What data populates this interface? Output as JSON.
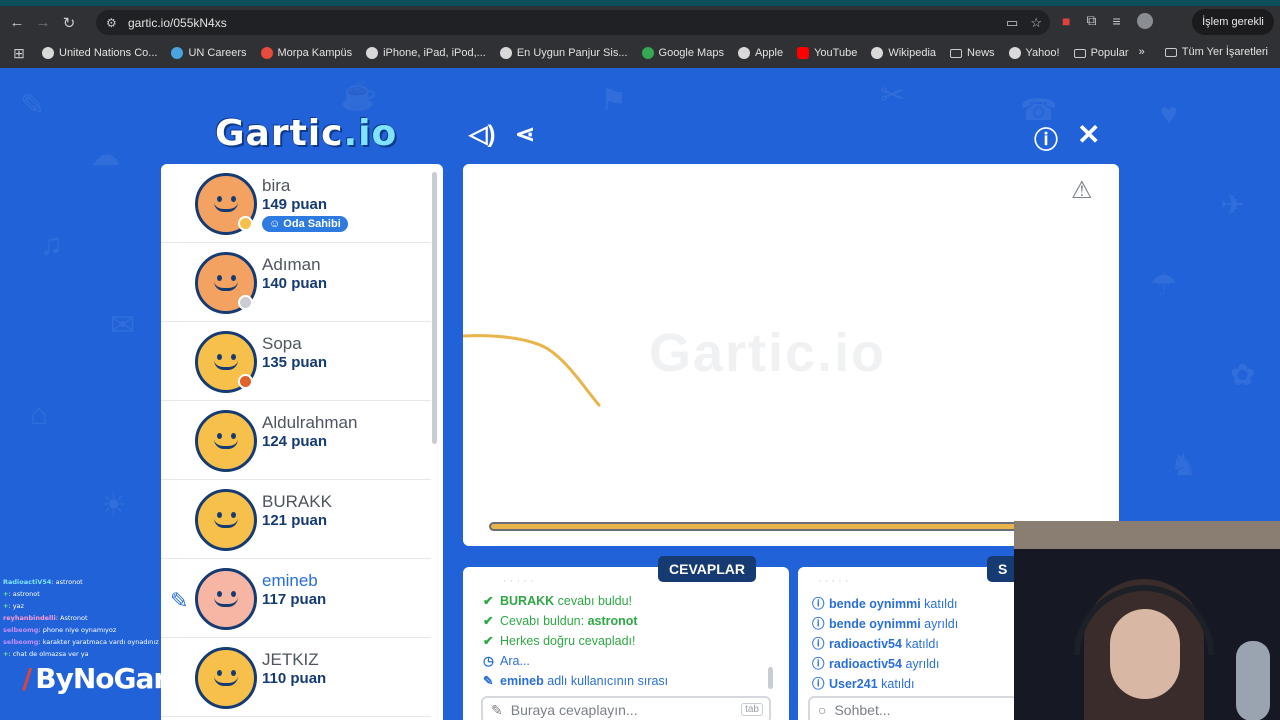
{
  "browser": {
    "url": "gartic.io/055kN4xs",
    "pending_label": "İşlem gerekli",
    "bookmarks": [
      {
        "label": "United Nations Co...",
        "color": "#d9d9d9"
      },
      {
        "label": "UN Careers",
        "color": "#4aa3df"
      },
      {
        "label": "Morpa Kampüs",
        "color": "#e84a3c"
      },
      {
        "label": "iPhone, iPad, iPod,...",
        "color": "#d9d9d9"
      },
      {
        "label": "En Uygun Panjur Sis...",
        "color": "#d9d9d9"
      },
      {
        "label": "Google Maps",
        "color": "#34a853"
      },
      {
        "label": "Apple",
        "color": "#d9d9d9"
      },
      {
        "label": "YouTube",
        "color": "#ff0000"
      },
      {
        "label": "Wikipedia",
        "color": "#d9d9d9"
      },
      {
        "label": "News",
        "color": "folder"
      },
      {
        "label": "Yahoo!",
        "color": "#d9d9d9"
      },
      {
        "label": "Popular",
        "color": "folder"
      }
    ],
    "all_bookmarks_label": "Tüm Yer İşaretleri"
  },
  "game": {
    "logo_main": "Gartic",
    "logo_suffix": ".io",
    "canvas_watermark": "Gartic.io",
    "players": [
      {
        "name": "bira",
        "score": "149 puan",
        "badge": "Oda Sahibi",
        "status_color": "#f6c04a",
        "avatar_color": "#f4a261"
      },
      {
        "name": "Adıman",
        "score": "140 puan",
        "status_color": "#c9ccd2",
        "avatar_color": "#f4a261"
      },
      {
        "name": "Sopa",
        "score": "135 puan",
        "status_color": "#e0622c",
        "avatar_color": "#f6c04a"
      },
      {
        "name": "Aldulrahman",
        "score": "124 puan",
        "status_color": "",
        "avatar_color": "#f6c04a"
      },
      {
        "name": "BURAKK",
        "score": "121 puan",
        "status_color": "",
        "avatar_color": "#f6c04a"
      },
      {
        "name": "emineb",
        "score": "117 puan",
        "status_color": "",
        "avatar_color": "#f7b6a3",
        "drawing": true
      },
      {
        "name": "JETKIZ",
        "score": "110 puan",
        "status_color": "",
        "avatar_color": "#f6c04a"
      }
    ],
    "answers_tab": "CEVAPLAR",
    "chat_tab": "S",
    "answers_log": [
      {
        "icon": "✔",
        "who": "BURAKK",
        "text": " cevabı buldu!",
        "color": "green"
      },
      {
        "icon": "✔",
        "who": "",
        "text": "Cevabı buldun: ",
        "extra": "astronot",
        "color": "green"
      },
      {
        "icon": "✔",
        "who": "",
        "text": "Herkes doğru cevapladı!",
        "color": "green"
      },
      {
        "icon": "◷",
        "who": "",
        "text": "Ara...",
        "color": "blue"
      },
      {
        "icon": "✎",
        "who": "emineb",
        "text": " adlı kullanıcının sırası",
        "color": "blue"
      }
    ],
    "chat_log": [
      {
        "icon": "ⓘ",
        "who": "bende oynimmi",
        "text": " katıldı"
      },
      {
        "icon": "ⓘ",
        "who": "bende oynimmi",
        "text": " ayrıldı"
      },
      {
        "icon": "ⓘ",
        "who": "radioactiv54",
        "text": " katıldı"
      },
      {
        "icon": "ⓘ",
        "who": "radioactiv54",
        "text": " ayrıldı"
      },
      {
        "icon": "ⓘ",
        "who": "User241",
        "text": " katıldı"
      }
    ],
    "answer_placeholder": "Buraya cevaplayın...",
    "tab_key": "tab",
    "chat_placeholder": "Sohbet...",
    "timer_fraction": 1.0
  },
  "stream_overlay": {
    "chat_lines": [
      {
        "user": "RadioactiV54",
        "msg": ": astronot"
      },
      {
        "user": "+",
        "msg": ": astronot"
      },
      {
        "user": "+",
        "msg": ": yaz"
      },
      {
        "user": "reyhanbindelli",
        "msg": ": Astronot"
      },
      {
        "user": "selbeomg",
        "msg": ": phone niye oynamıyoz"
      },
      {
        "user": "selbeomg",
        "msg": ": karakter yaratmaca vardı oynadınız mı"
      },
      {
        "user": "+",
        "msg": ": chat de olmazsa ver ya"
      }
    ],
    "brand": "ByNoGar"
  }
}
